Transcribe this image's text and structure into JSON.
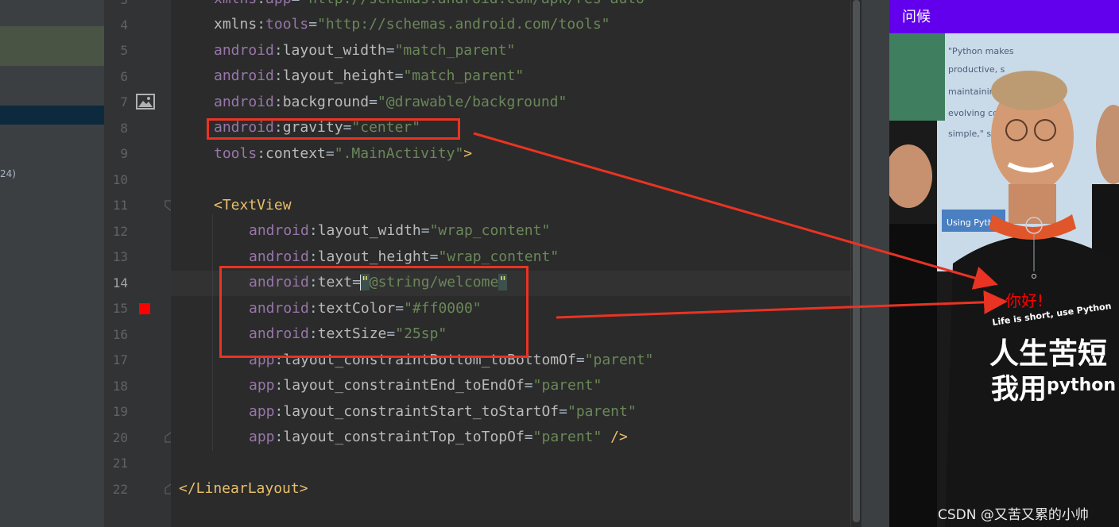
{
  "left_panel": {
    "fragment": "24)"
  },
  "line_numbers": [
    "3",
    "4",
    "5",
    "6",
    "7",
    "8",
    "9",
    "10",
    "11",
    "12",
    "13",
    "14",
    "15",
    "16",
    "17",
    "18",
    "19",
    "20",
    "21",
    "22"
  ],
  "code_lines": {
    "l3": {
      "ns": "xmlns",
      "colon": ":",
      "attr": "app",
      "eq": "=",
      "val": "\"http://schemas.android.com/apk/res-auto\""
    },
    "l4": {
      "ns": "xmlns",
      "colon": ":",
      "attr": "tools",
      "eq": "=",
      "val": "\"http://schemas.android.com/tools\""
    },
    "l5": {
      "ns": "android",
      "colon": ":",
      "attr": "layout_width",
      "eq": "=",
      "val": "\"match_parent\""
    },
    "l6": {
      "ns": "android",
      "colon": ":",
      "attr": "layout_height",
      "eq": "=",
      "val": "\"match_parent\""
    },
    "l7": {
      "ns": "android",
      "colon": ":",
      "attr": "background",
      "eq": "=",
      "val": "\"@drawable/background\""
    },
    "l8": {
      "ns": "android",
      "colon": ":",
      "attr": "gravity",
      "eq": "=",
      "val": "\"center\""
    },
    "l9": {
      "ns": "tools",
      "colon": ":",
      "attr": "context",
      "eq": "=",
      "val": "\".MainActivity\"",
      "close": ">"
    },
    "l11": {
      "tag": "<TextView"
    },
    "l12": {
      "ns": "android",
      "colon": ":",
      "attr": "layout_width",
      "eq": "=",
      "val": "\"wrap_content\""
    },
    "l13": {
      "ns": "android",
      "colon": ":",
      "attr": "layout_height",
      "eq": "=",
      "val": "\"wrap_content\""
    },
    "l14": {
      "ns": "android",
      "colon": ":",
      "attr": "text",
      "eq": "=",
      "q1": "\"",
      "val": "@string/welcome",
      "q2": "\""
    },
    "l15": {
      "ns": "android",
      "colon": ":",
      "attr": "textColor",
      "eq": "=",
      "val": "\"#ff0000\""
    },
    "l16": {
      "ns": "android",
      "colon": ":",
      "attr": "textSize",
      "eq": "=",
      "val": "\"25sp\""
    },
    "l17": {
      "ns": "app",
      "colon": ":",
      "attr": "layout_constraintBottom_toBottomOf",
      "eq": "=",
      "val": "\"parent\""
    },
    "l18": {
      "ns": "app",
      "colon": ":",
      "attr": "layout_constraintEnd_toEndOf",
      "eq": "=",
      "val": "\"parent\""
    },
    "l19": {
      "ns": "app",
      "colon": ":",
      "attr": "layout_constraintStart_toStartOf",
      "eq": "=",
      "val": "\"parent\""
    },
    "l20": {
      "ns": "app",
      "colon": ":",
      "attr": "layout_constraintTop_toTopOf",
      "eq": "=",
      "val": "\"parent\"",
      "close": " />"
    },
    "l22": {
      "tag": "</LinearLayout>"
    }
  },
  "preview": {
    "title": "问候",
    "greeting": "你好!",
    "photo_text": {
      "line1": "Life is short, use Python",
      "line2": "人生苦短",
      "line3a": "我用",
      "line3b": "python",
      "poster1": "\"Python makes",
      "poster2": "productive, s",
      "poster3": "maintaining",
      "poster4": "evolving cod",
      "poster5": "simple,\" sai",
      "sign": "Using Python"
    }
  },
  "watermark": "CSDN @又苦又累的小帅",
  "colors": {
    "annotation_red": "#ea3323",
    "action_bar": "#6200ee",
    "greeting_red": "#ff0000"
  }
}
